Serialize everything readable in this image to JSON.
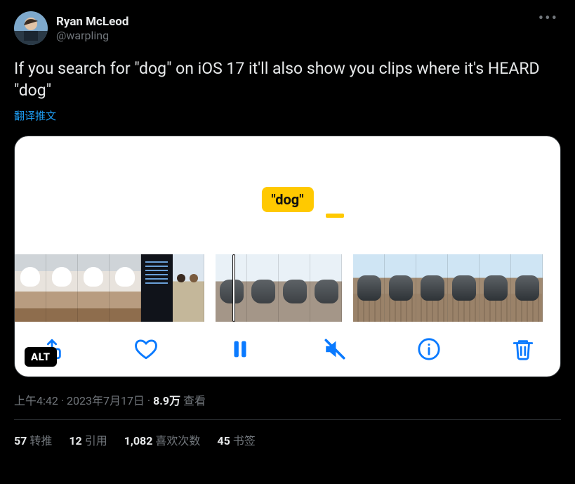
{
  "author": {
    "display_name": "Ryan McLeod",
    "handle": "@warpling"
  },
  "body_text": "If you search for \"dog\" on iOS 17 it'll also show you clips where it's HEARD \"dog\"",
  "translate_label": "翻译推文",
  "media": {
    "search_chip": "\"dog\"",
    "alt_badge": "ALT",
    "toolbar": {
      "share": "share",
      "like": "like",
      "pause": "pause",
      "mute": "mute",
      "info": "info",
      "trash": "trash"
    }
  },
  "meta": {
    "time": "上午4:42",
    "date": "2023年7月17日",
    "separator": " · ",
    "views_value": "8.9万",
    "views_label": " 查看"
  },
  "stats": {
    "retweets": {
      "n": "57",
      "label": "转推"
    },
    "quotes": {
      "n": "12",
      "label": "引用"
    },
    "likes": {
      "n": "1,082",
      "label": "喜欢次数"
    },
    "bookmarks": {
      "n": "45",
      "label": "书签"
    }
  }
}
